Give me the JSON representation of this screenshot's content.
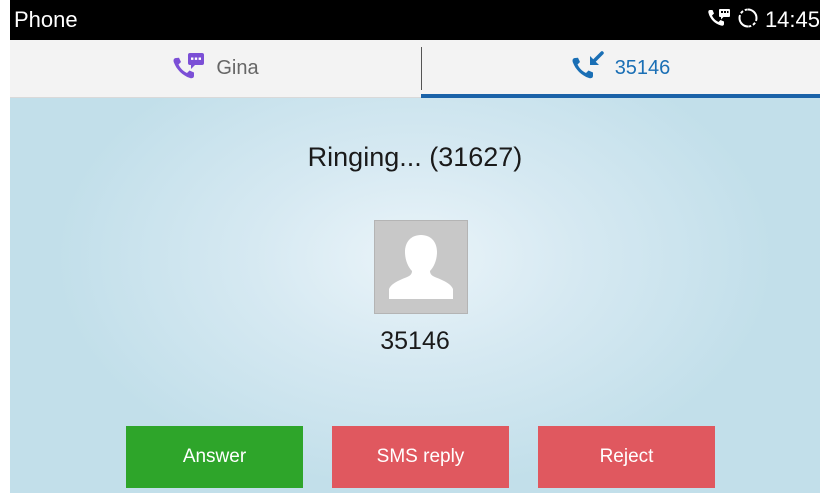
{
  "status_bar": {
    "app_title": "Phone",
    "time": "14:45",
    "icons": [
      "call-voicemail-icon",
      "sync-circle-icon"
    ]
  },
  "tabs": [
    {
      "label": "Gina",
      "icon": "phone-message-icon",
      "active": false
    },
    {
      "label": "35146",
      "icon": "phone-incoming-icon",
      "active": true
    }
  ],
  "call": {
    "status": "Ringing... (31627)",
    "caller_number": "35146",
    "avatar_icon": "default-contact-avatar-icon"
  },
  "actions": {
    "answer_label": "Answer",
    "sms_reply_label": "SMS reply",
    "reject_label": "Reject"
  },
  "colors": {
    "accent": "#1a62a8",
    "answer": "#2ea52a",
    "reject": "#e0585f",
    "tab_icon_inactive": "#7b4fd6"
  }
}
